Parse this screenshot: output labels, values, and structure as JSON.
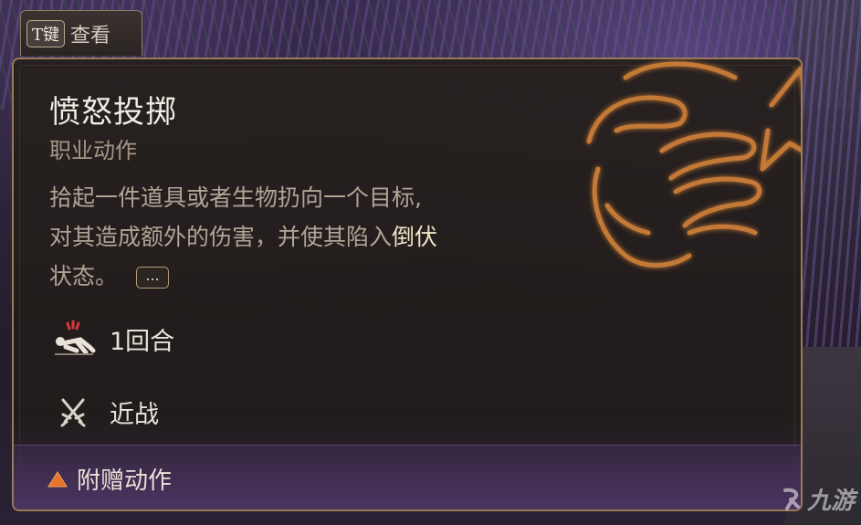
{
  "hint_tab": {
    "key": "T键",
    "label": "查看"
  },
  "tooltip": {
    "title": "愤怒投掷",
    "subtitle": "职业动作",
    "description_parts": {
      "line1": "拾起一件道具或者生物扔向一个目标,",
      "line2_prefix": "对其造成额外的伤害，并使其陷入",
      "keyword": "倒伏",
      "line3": "状态。"
    },
    "more_button": "...",
    "duration": "1回合",
    "range": "近战",
    "action_type": "附赠动作",
    "icons": {
      "emblem": "enraged-fist-icon",
      "duration": "prone-condition-icon",
      "range": "crossed-swords-icon",
      "action_type": "bonus-action-triangle-icon"
    }
  },
  "watermark": {
    "text": "九游"
  },
  "colors": {
    "panel_border": "#9b7a58",
    "title": "#f2ede4",
    "emblem_glow": "#e08a3a",
    "bonus_triangle": "#e5742b"
  }
}
